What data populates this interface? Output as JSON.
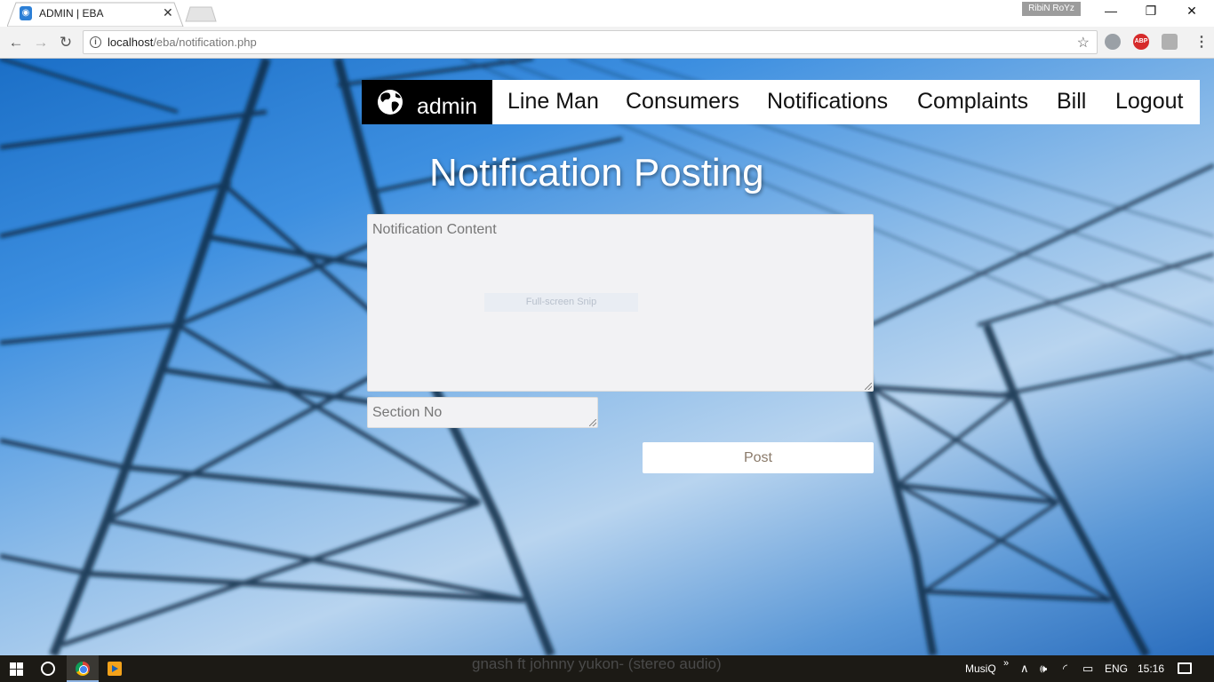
{
  "browser": {
    "tab_title": "ADMIN | EBA",
    "tab_close": "✕",
    "profile_name": "RibiN RoYz",
    "url_host": "localhost",
    "url_path": "/eba/notification.php",
    "window_controls": {
      "minimize": "—",
      "restore": "❐",
      "close": "✕"
    },
    "nav": {
      "back": "←",
      "forward": "→",
      "reload": "↻"
    }
  },
  "navbar": {
    "brand": "admin",
    "items": [
      {
        "label": "Line Man"
      },
      {
        "label": "Consumers"
      },
      {
        "label": "Notifications"
      },
      {
        "label": "Complaints"
      },
      {
        "label": "Bill"
      },
      {
        "label": "Logout"
      }
    ]
  },
  "page": {
    "heading": "Notification Posting",
    "content_placeholder": "Notification Content",
    "section_placeholder": "Section No",
    "post_label": "Post",
    "snip_overlay": "Full-screen Snip"
  },
  "taskbar": {
    "now_playing": "gnash ft johnny yukon- (stereo audio)",
    "tray_app": "MusiQ",
    "language": "ENG",
    "time": "15:16"
  },
  "colors": {
    "sky_blue": "#3d8fe0",
    "brand_bg": "#000000",
    "navbar_bg": "#ffffff",
    "taskbar_bg": "#1c1a15"
  }
}
